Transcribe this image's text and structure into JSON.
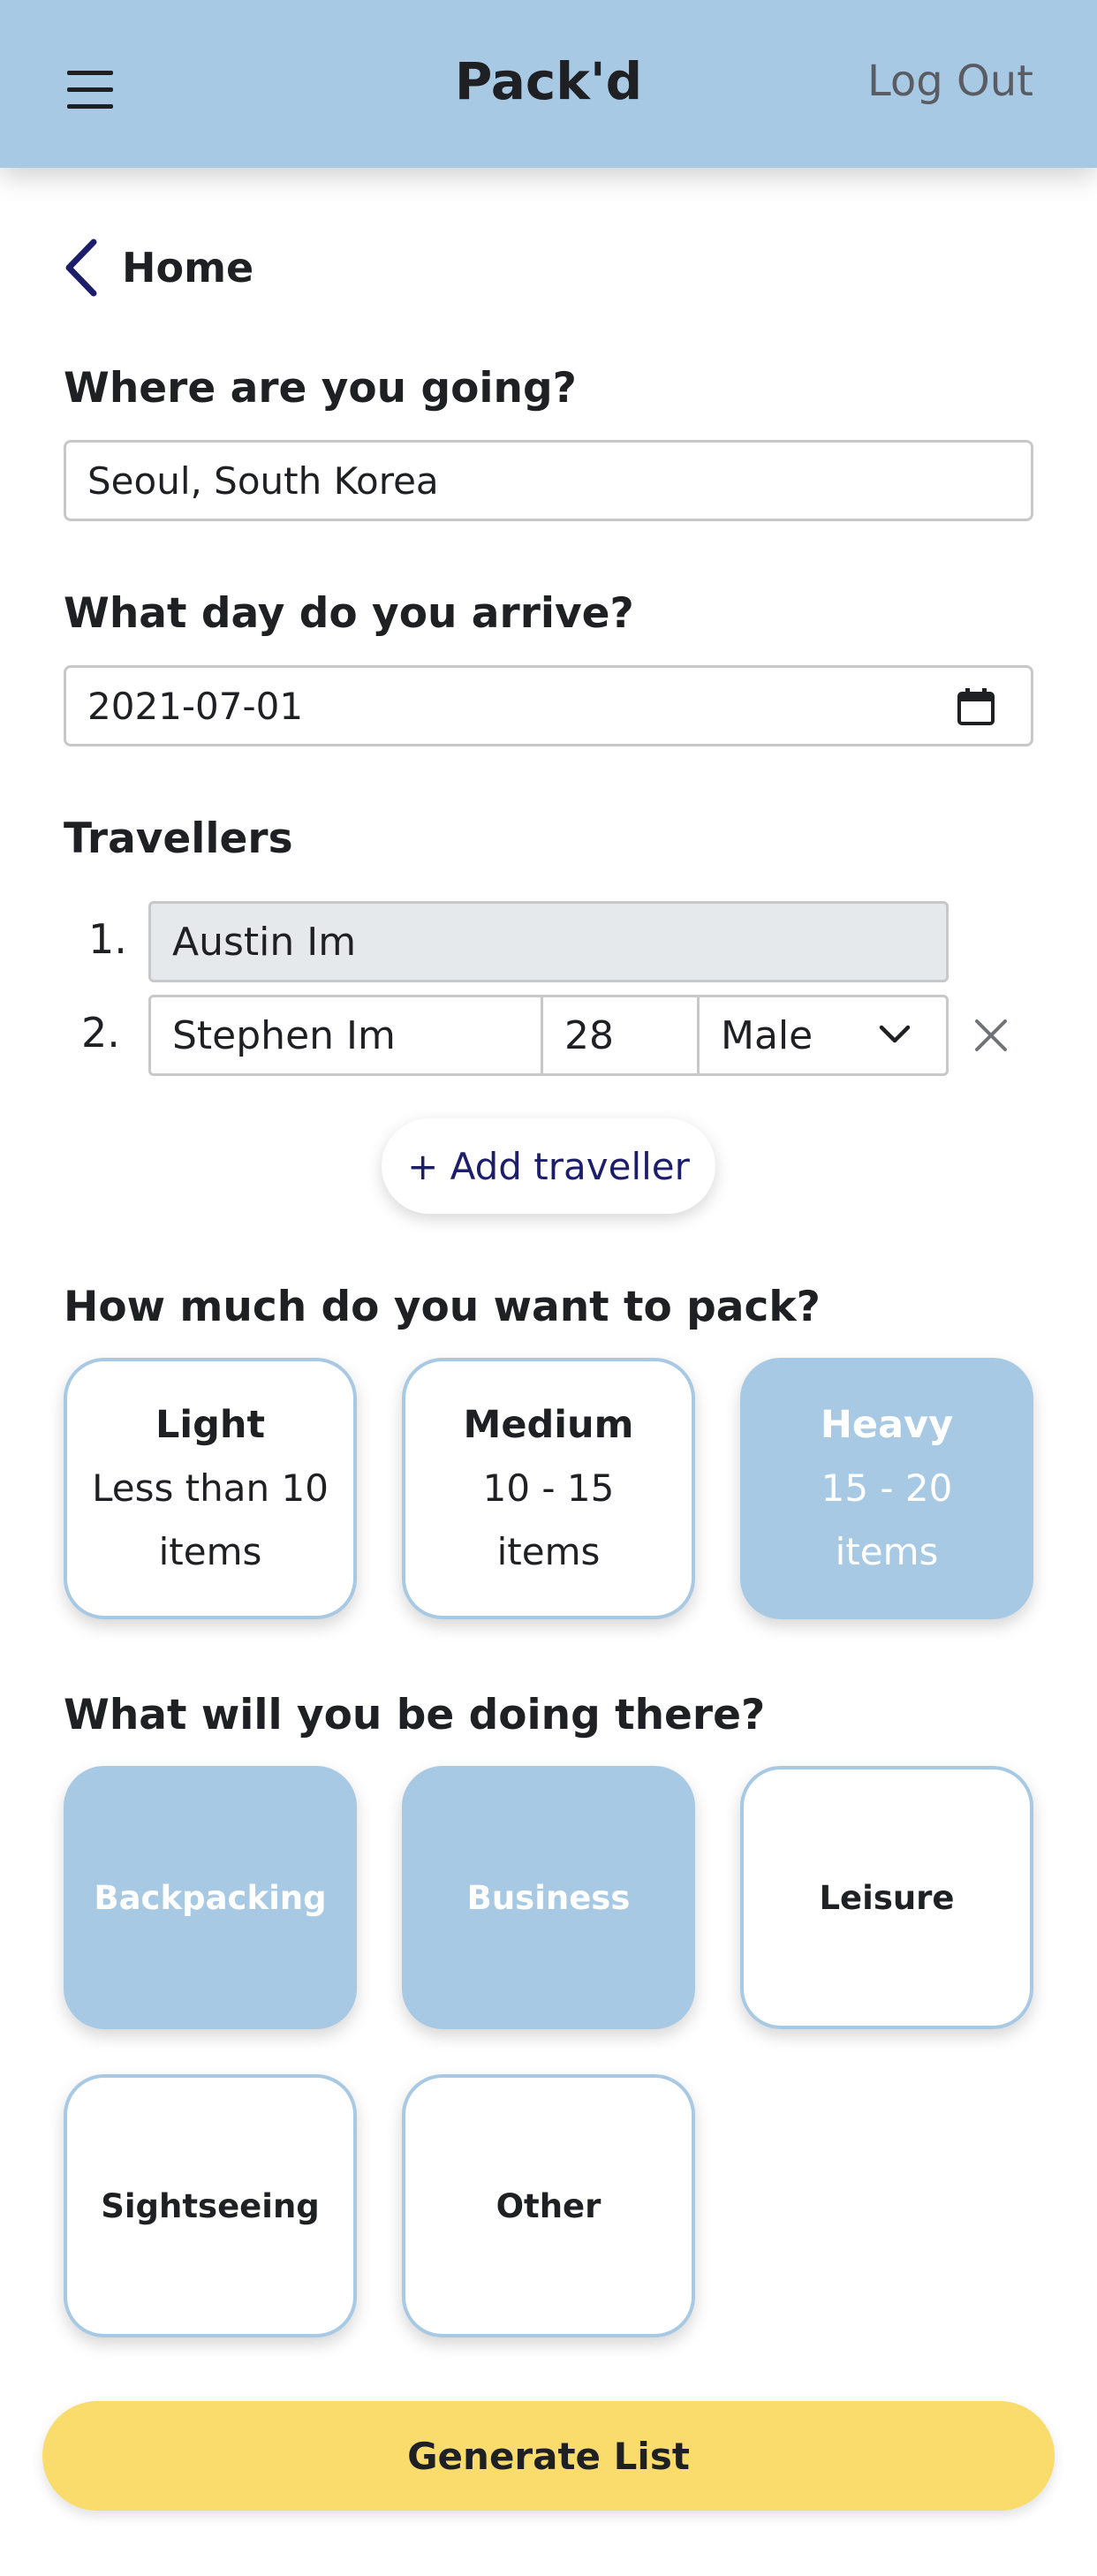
{
  "header": {
    "title": "Pack'd",
    "logout_label": "Log Out"
  },
  "nav": {
    "back_label": "Home"
  },
  "destination": {
    "question": "Where are you going?",
    "value": "Seoul, South Korea"
  },
  "arrival": {
    "question": "What day do you arrive?",
    "value": "2021-07-01"
  },
  "travellers": {
    "heading": "Travellers",
    "list": [
      {
        "number": "1.",
        "name": "Austin Im"
      },
      {
        "number": "2.",
        "name": "Stephen Im",
        "age": "28",
        "gender": "Male"
      }
    ],
    "add_label": "+ Add traveller"
  },
  "packing": {
    "question": "How much do you want to pack?",
    "options": [
      {
        "title": "Light",
        "desc": "Less than 10 items",
        "selected": false
      },
      {
        "title": "Medium",
        "desc": "10 - 15 items",
        "selected": false
      },
      {
        "title": "Heavy",
        "desc": "15 - 20 items",
        "selected": true
      }
    ]
  },
  "activities": {
    "question": "What will you be doing there?",
    "options": [
      {
        "label": "Backpacking",
        "selected": true
      },
      {
        "label": "Business",
        "selected": true
      },
      {
        "label": "Leisure",
        "selected": false
      },
      {
        "label": "Sightseeing",
        "selected": false
      },
      {
        "label": "Other",
        "selected": false
      }
    ]
  },
  "generate_label": "Generate List",
  "colors": {
    "header_bg": "#a8c9e4",
    "selected_bg": "#a8c9e4",
    "generate_bg": "#f9dc6b",
    "link": "#1c1e6b"
  },
  "icons": [
    "menu-icon",
    "back-chevron-icon",
    "calendar-icon",
    "chevron-down-icon",
    "close-icon"
  ]
}
